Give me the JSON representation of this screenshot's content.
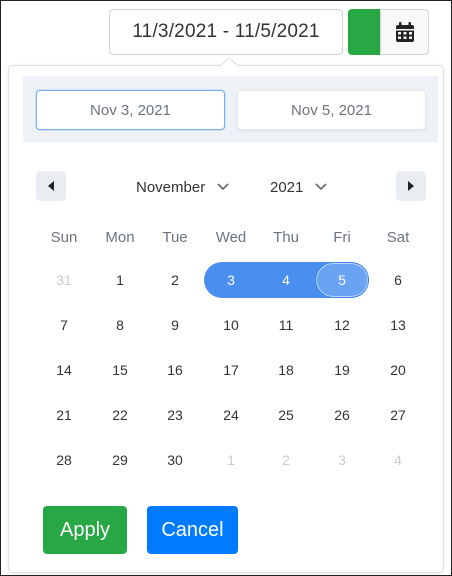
{
  "trigger": {
    "range_text": "11/3/2021 - 11/5/2021",
    "icon": "calendar-icon",
    "accent_green": "#28a745"
  },
  "picker": {
    "start_value": "Nov 3, 2021",
    "end_value": "Nov 5, 2021",
    "month": "November",
    "year": "2021",
    "weekdays": [
      "Sun",
      "Mon",
      "Tue",
      "Wed",
      "Thu",
      "Fri",
      "Sat"
    ],
    "weeks": [
      [
        "31",
        "1",
        "2",
        "3",
        "4",
        "5",
        "6"
      ],
      [
        "7",
        "8",
        "9",
        "10",
        "11",
        "12",
        "13"
      ],
      [
        "14",
        "15",
        "16",
        "17",
        "18",
        "19",
        "20"
      ],
      [
        "21",
        "22",
        "23",
        "24",
        "25",
        "26",
        "27"
      ],
      [
        "28",
        "29",
        "30",
        "1",
        "2",
        "3",
        "4"
      ]
    ],
    "range_color": "#4a8ff0"
  },
  "actions": {
    "apply_label": "Apply",
    "cancel_label": "Cancel",
    "apply_color": "#28a745",
    "cancel_color": "#007bff"
  }
}
